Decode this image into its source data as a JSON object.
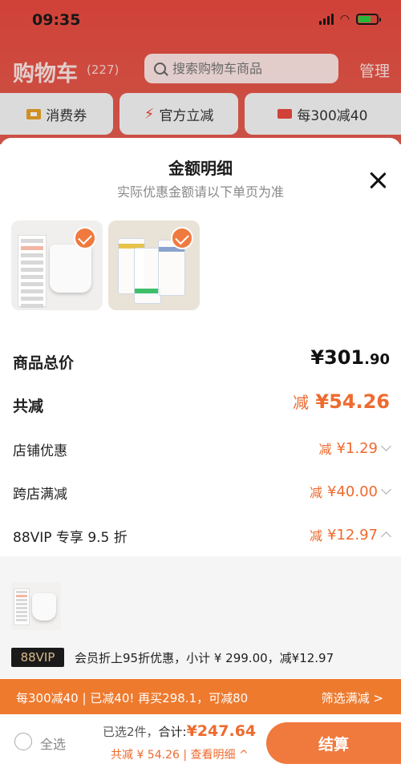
{
  "status_bar": {
    "time": "09:35"
  },
  "header": {
    "title": "购物车",
    "count": "(227)",
    "search_placeholder": "搜索购物车商品",
    "manage": "管理"
  },
  "coupons": [
    {
      "label": "消费券"
    },
    {
      "label": "官方立减"
    },
    {
      "label": "每300减40"
    }
  ],
  "sheet": {
    "title": "金额明细",
    "subtitle": "实际优惠金额请以下单页为准",
    "rows": {
      "total": {
        "label": "商品总价",
        "value_int": "¥301",
        "value_dec": ".90"
      },
      "discount": {
        "label": "共减",
        "prefix": "减",
        "value": "¥54.26"
      },
      "shop": {
        "label": "店铺优惠",
        "prefix": "减",
        "value": "¥1.29"
      },
      "cross": {
        "label": "跨店满减",
        "prefix": "减",
        "value": "¥40.00"
      },
      "vip": {
        "label": "88VIP 专享 9.5 折",
        "prefix": "减",
        "value": "¥12.97"
      }
    },
    "vip_badge": "88VIP",
    "vip_text": "会员折上95折优惠，小计 ¥ 299.00，减¥12.97"
  },
  "promo": {
    "left": "每300减40 | 已减40! 再买298.1，可减80",
    "right": "筛选满减 >"
  },
  "footer": {
    "select_all": "全选",
    "selected": "已选2件，",
    "sum_label": "合计:",
    "sum_value": "¥247.64",
    "saving": "共减 ¥ 54.26 | 查看明细 ^",
    "checkout": "结算"
  },
  "colors": {
    "accent": "#ee6a2e",
    "header_red": "#e8493f"
  }
}
